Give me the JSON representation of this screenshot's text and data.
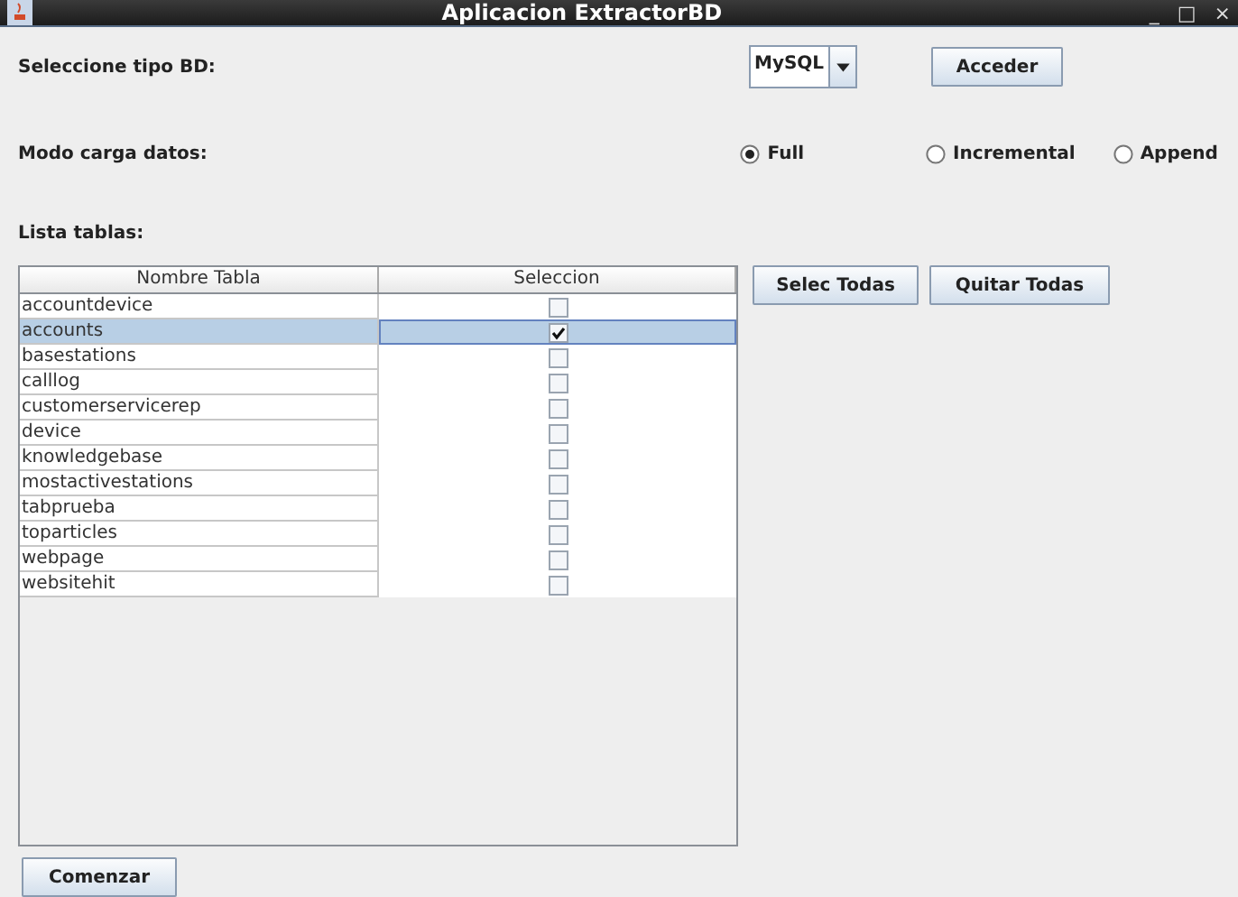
{
  "window": {
    "title": "Aplicacion ExtractorBD",
    "controls": [
      "_",
      "□",
      "×"
    ]
  },
  "db_type": {
    "label": "Seleccione tipo BD:",
    "value": "MySQL",
    "button": "Acceder"
  },
  "load_mode": {
    "label": "Modo carga datos:",
    "options": [
      {
        "label": "Full",
        "selected": true
      },
      {
        "label": "Incremental",
        "selected": false
      },
      {
        "label": "Append",
        "selected": false
      }
    ]
  },
  "tables": {
    "label": "Lista tablas:",
    "columns": [
      "Nombre Tabla",
      "Seleccion"
    ],
    "rows": [
      {
        "name": "accountdevice",
        "checked": false,
        "selected": false
      },
      {
        "name": "accounts",
        "checked": true,
        "selected": true
      },
      {
        "name": "basestations",
        "checked": false,
        "selected": false
      },
      {
        "name": "calllog",
        "checked": false,
        "selected": false
      },
      {
        "name": "customerservicerep",
        "checked": false,
        "selected": false
      },
      {
        "name": "device",
        "checked": false,
        "selected": false
      },
      {
        "name": "knowledgebase",
        "checked": false,
        "selected": false
      },
      {
        "name": "mostactivestations",
        "checked": false,
        "selected": false
      },
      {
        "name": "tabprueba",
        "checked": false,
        "selected": false
      },
      {
        "name": "toparticles",
        "checked": false,
        "selected": false
      },
      {
        "name": "webpage",
        "checked": false,
        "selected": false
      },
      {
        "name": "websitehit",
        "checked": false,
        "selected": false
      }
    ]
  },
  "table_buttons": [
    "Selec Todas",
    "Quitar Todas"
  ],
  "start_button": "Comenzar"
}
